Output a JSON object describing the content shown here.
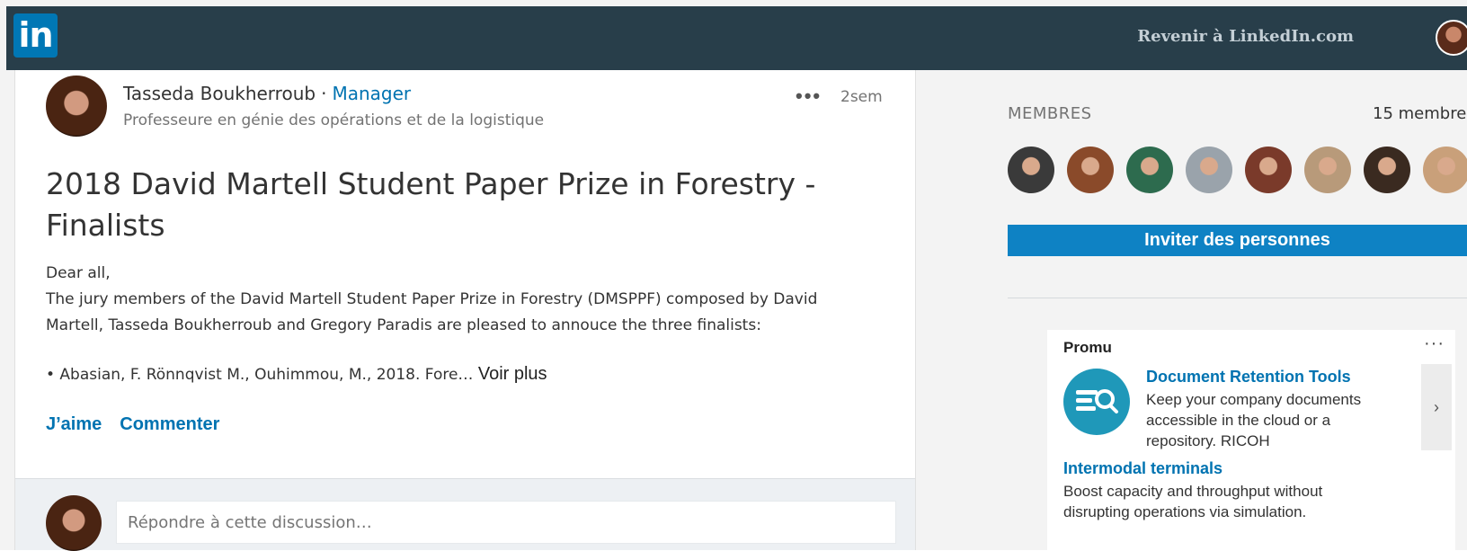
{
  "header": {
    "logo_text": "in",
    "back_link": "Revenir à LinkedIn.com"
  },
  "post": {
    "author_name": "Tasseda Boukherroub",
    "separator": "·",
    "author_role": "Manager",
    "author_headline": "Professeure en génie des opérations et de la logistique",
    "more_label": "•••",
    "time": "2sem",
    "title": "2018 David Martell Student Paper Prize in Forestry - Finalists",
    "body_line1": "Dear all,",
    "body_line2": "The jury members of the David Martell Student Paper Prize in Forestry (DMSPPF) composed by David Martell, Tasseda Boukherroub and Gregory Paradis are pleased to annouce the three finalists:",
    "bullet_text": "• Abasian, F. Rönnqvist M., Ouhimmou, M., 2018. Fore…",
    "see_more": "Voir plus",
    "like_label": "J’aime",
    "comment_label": "Commenter"
  },
  "reply": {
    "placeholder": "Répondre à cette discussion…"
  },
  "sidebar": {
    "members_label": "MEMBRES",
    "members_count": "15 membres",
    "member_avatars": [
      {
        "color": "#3a3a3a"
      },
      {
        "color": "#8a4a2a"
      },
      {
        "color": "#2d6b4e"
      },
      {
        "color": "#9aa3ab"
      },
      {
        "color": "#7a3a2a"
      },
      {
        "color": "#b89a7a"
      },
      {
        "color": "#3a2a20"
      },
      {
        "color": "#c9a07a"
      }
    ],
    "invite_label": "Inviter des personnes"
  },
  "ad": {
    "promo_label": "Promu",
    "more_label": "···",
    "title": "Document Retention Tools",
    "description": "Keep your company documents accessible in the cloud or a repository. RICOH",
    "next_label": "›",
    "second_title": "Intermodal terminals",
    "second_description": "Boost capacity and throughput without disrupting operations via simulation."
  },
  "colors": {
    "topbar": "#283e4a",
    "brand": "#0077b5",
    "link": "#0073b1",
    "button": "#0e82c4"
  }
}
